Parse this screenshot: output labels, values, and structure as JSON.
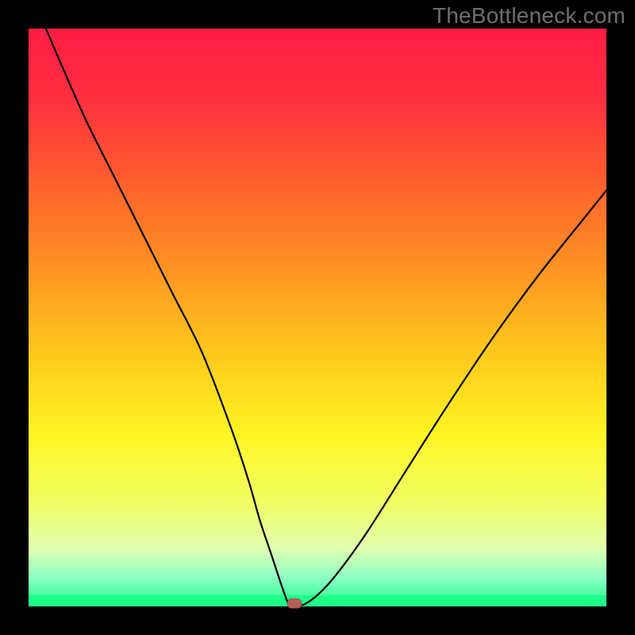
{
  "watermark": "TheBottleneck.com",
  "chart_data": {
    "type": "line",
    "title": "",
    "xlabel": "",
    "ylabel": "",
    "xlim": [
      0,
      100
    ],
    "ylim": [
      0,
      100
    ],
    "curve": {
      "name": "bottleneck-curve",
      "x": [
        3,
        6,
        10,
        15,
        20,
        25,
        30,
        35,
        38,
        40,
        42,
        44,
        45,
        46,
        48,
        52,
        58,
        65,
        72,
        80,
        88,
        96,
        100
      ],
      "y": [
        100,
        93,
        84,
        74,
        64,
        54,
        44,
        31,
        22,
        15,
        9,
        3,
        0.5,
        0.5,
        0.5,
        4,
        12,
        23,
        34,
        46,
        57,
        67,
        72
      ]
    },
    "marker": {
      "name": "current-point",
      "x": 46,
      "y": 0.5,
      "color": "#b75d57"
    },
    "background_gradient": {
      "stops": [
        {
          "pos": 0.0,
          "color": "#ff1d44"
        },
        {
          "pos": 0.12,
          "color": "#ff2f3f"
        },
        {
          "pos": 0.25,
          "color": "#ff5a2f"
        },
        {
          "pos": 0.4,
          "color": "#ff8e23"
        },
        {
          "pos": 0.55,
          "color": "#ffc41c"
        },
        {
          "pos": 0.7,
          "color": "#fff523"
        },
        {
          "pos": 0.82,
          "color": "#f2ff63"
        },
        {
          "pos": 0.9,
          "color": "#e0ffb0"
        },
        {
          "pos": 0.95,
          "color": "#8dffc4"
        },
        {
          "pos": 1.0,
          "color": "#1eff8a"
        }
      ]
    },
    "frame": {
      "top_inset": 36,
      "left": 36,
      "right": 36,
      "bottom": 36,
      "bottom_green_band": 14
    }
  }
}
